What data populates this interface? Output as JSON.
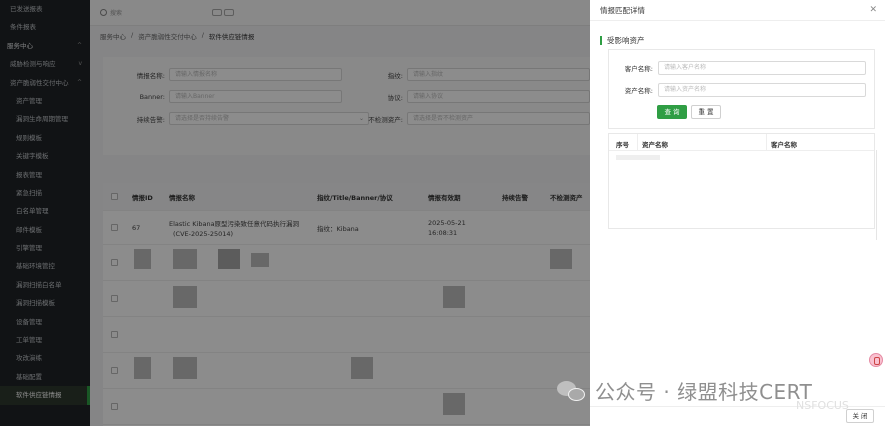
{
  "sidebar": {
    "items": [
      {
        "label": "已发送报表",
        "level": "top"
      },
      {
        "label": "条件报表",
        "level": "top"
      },
      {
        "label": "服务中心",
        "level": "group",
        "expand": "^"
      },
      {
        "label": "威胁检测与响应",
        "level": "sub",
        "expand": "v"
      },
      {
        "label": "资产脆弱性交付中心",
        "level": "sub",
        "expand": "^"
      },
      {
        "label": "资产管理",
        "level": "leaf"
      },
      {
        "label": "漏洞生命周期管理",
        "level": "leaf"
      },
      {
        "label": "规则模板",
        "level": "leaf"
      },
      {
        "label": "关键字模板",
        "level": "leaf"
      },
      {
        "label": "报表管理",
        "level": "leaf"
      },
      {
        "label": "紧急扫描",
        "level": "leaf"
      },
      {
        "label": "白名单管理",
        "level": "leaf"
      },
      {
        "label": "邮件模板",
        "level": "leaf"
      },
      {
        "label": "引擎管理",
        "level": "leaf"
      },
      {
        "label": "基础环境管控",
        "level": "leaf"
      },
      {
        "label": "漏洞扫描白名单",
        "level": "leaf"
      },
      {
        "label": "漏洞扫描模板",
        "level": "leaf"
      },
      {
        "label": "设备管理",
        "level": "leaf"
      },
      {
        "label": "工单管理",
        "level": "leaf"
      },
      {
        "label": "攻改演练",
        "level": "leaf"
      },
      {
        "label": "基础配置",
        "level": "leaf"
      },
      {
        "label": "软件供应链情报",
        "level": "leaf",
        "active": true
      }
    ]
  },
  "topbar": {
    "search_label": "搜索"
  },
  "breadcrumb": {
    "items": [
      "服务中心",
      "/",
      "资产脆弱性交付中心",
      "/",
      "软件供应链情报"
    ]
  },
  "filter": {
    "name_label": "情报名称:",
    "name_placeholder": "请输入情报名称",
    "fingerprint_label": "指纹:",
    "fingerprint_placeholder": "请输入指纹",
    "banner_label": "Banner:",
    "banner_placeholder": "请输入Banner",
    "protocol_label": "协议:",
    "protocol_placeholder": "请输入协议",
    "alert_label": "持续告警:",
    "alert_placeholder": "请选择是否持续告警",
    "undetected_label": "不检测资产:",
    "undetected_placeholder": "请选择是否不检测资产"
  },
  "table": {
    "columns": [
      "情报ID",
      "情报名称",
      "指纹/Title/Banner/协议",
      "情报有效期",
      "持续告警",
      "不检测资产"
    ],
    "rows": [
      {
        "id": "67",
        "name_line1": "Elastic Kibana原型污染致任意代码执行漏洞",
        "name_line2": "(CVE-2025-25014)",
        "fingerprint": "指纹：Kibana",
        "validity_line1": "2025-05-21",
        "validity_line2": "16:08:31"
      }
    ]
  },
  "drawer": {
    "title": "情报匹配详情",
    "close_icon": "close-icon",
    "section_title": "受影响资产",
    "query": {
      "customer_label": "客户名称:",
      "customer_placeholder": "请输入客户名称",
      "asset_label": "资产名称:",
      "asset_placeholder": "请输入资产名称",
      "query_button": "查 询",
      "reset_button": "重 置"
    },
    "result_columns": [
      "序号",
      "资产名称",
      "客户名称"
    ],
    "close_button": "关 闭"
  },
  "watermark": {
    "text": "公众号 · 绿盟科技CERT",
    "brand": "NSFOCUS"
  },
  "colors": {
    "accent": "#2f9e44",
    "sidebar_bg": "#1f2327"
  }
}
